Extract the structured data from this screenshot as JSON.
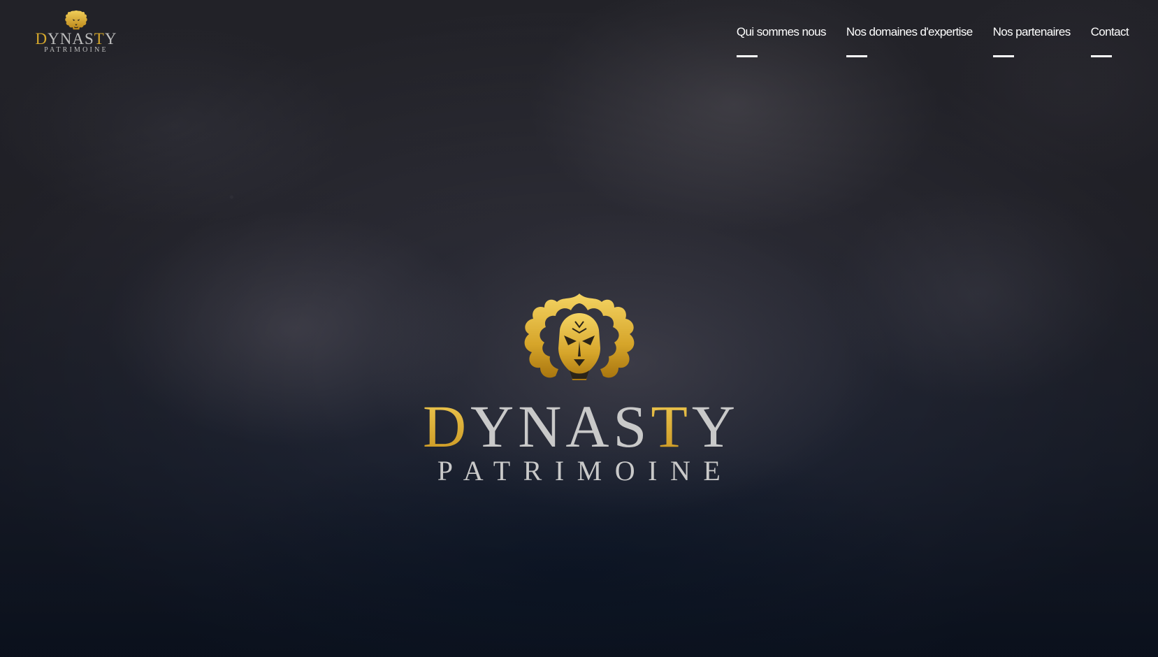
{
  "brand": {
    "name_letters": [
      "D",
      "Y",
      "N",
      "A",
      "S",
      "T",
      "Y"
    ],
    "name_gold_letters": [
      0,
      5
    ],
    "subtitle": "PATRIMOINE",
    "icon": "lion-head-icon",
    "gold_color": "#d4a72c",
    "silver_color": "#c9c9c9"
  },
  "nav": {
    "items": [
      {
        "label": "Qui sommes nous"
      },
      {
        "label": "Nos domaines d'expertise"
      },
      {
        "label": "Nos partenaires"
      },
      {
        "label": "Contact"
      }
    ]
  },
  "colors": {
    "background": "#1d2230",
    "nav_text": "#ffffff"
  }
}
